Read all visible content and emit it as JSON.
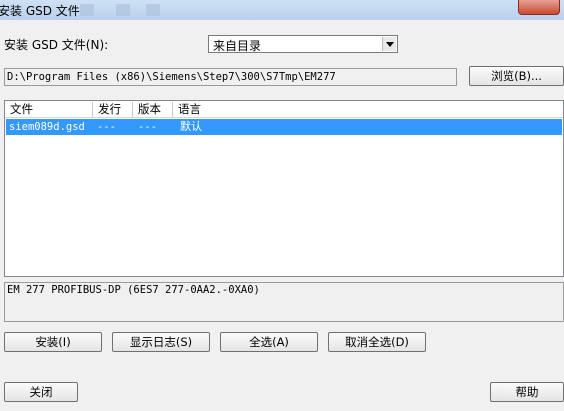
{
  "window": {
    "title": "安装 GSD 文件"
  },
  "install": {
    "label": "安装 GSD 文件(N):",
    "source_selected": "来自目录"
  },
  "path": {
    "value": "D:\\Program Files (x86)\\Siemens\\Step7\\300\\S7Tmp\\EM277",
    "browse_label": "浏览(B)..."
  },
  "list": {
    "columns": [
      "文件",
      "发行",
      "版本",
      "语言"
    ],
    "rows": [
      {
        "file": "siem089d.gsd",
        "release": "---",
        "version": "---",
        "language": "默认"
      }
    ]
  },
  "description": "EM 277 PROFIBUS-DP (6ES7 277-0AA2.-0XA0)",
  "buttons": {
    "install": "安装(I)",
    "show_log": "显示日志(S)",
    "select_all": "全选(A)",
    "deselect_all": "取消全选(D)",
    "close": "关闭",
    "help": "帮助"
  }
}
